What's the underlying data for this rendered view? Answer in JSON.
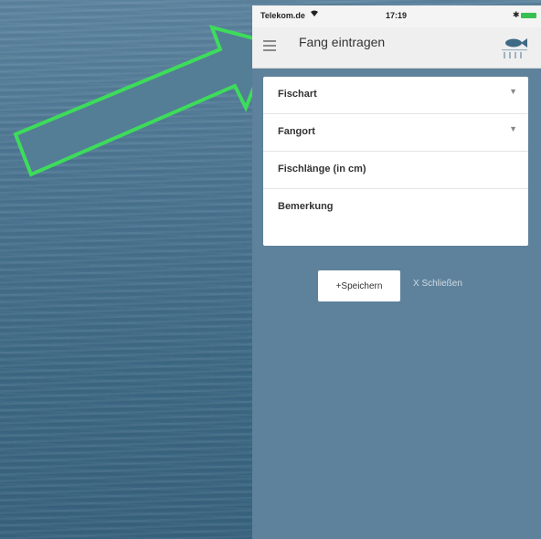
{
  "status_bar": {
    "carrier": "Telekom.de",
    "wifi_icon": "wifi-icon",
    "time": "17:19",
    "bluetooth_icon": "bluetooth-icon",
    "battery_color": "#38c152"
  },
  "app_bar": {
    "title": "Fang eintragen",
    "menu_icon": "hamburger-menu-icon",
    "logo_icon": "fish-logo-icon"
  },
  "form": {
    "fields": [
      {
        "label": "Fischart",
        "type": "select"
      },
      {
        "label": "Fangort",
        "type": "select"
      },
      {
        "label": "Fischlänge (in cm)",
        "type": "number"
      },
      {
        "label": "Bemerkung",
        "type": "textarea"
      }
    ]
  },
  "actions": {
    "save_label": "+Speichern",
    "close_label": "X Schließen"
  },
  "annotation": {
    "arrow_color": "#3ddc5a"
  }
}
